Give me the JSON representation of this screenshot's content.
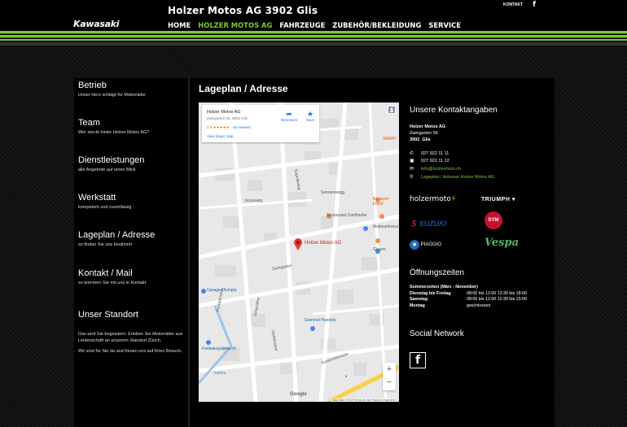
{
  "header": {
    "logo": "Kawasaki",
    "title": "Holzer Motos AG 3902 Glis",
    "top_link": "KONTAKT",
    "top_fb": "f",
    "nav": [
      "HOME",
      "HOLZER MOTOS AG",
      "FAHRZEUGE",
      "ZUBEHÖR/BEKLEIDUNG",
      "SERVICE"
    ],
    "active_nav": "HOLZER MOTOS AG",
    "accent": "#7cc832"
  },
  "sidebar": {
    "items": [
      {
        "title": "Betrieb",
        "sub": "Unser Herz schlägt für Motorräder"
      },
      {
        "title": "Team",
        "sub": "Wer steckt hinter Holzer Motos AG?"
      },
      {
        "title": "Dienstleistungen",
        "sub": "alle Angebote auf einen Blick"
      },
      {
        "title": "Werkstatt",
        "sub": "kompetent und zuverlässig"
      },
      {
        "title": "Lageplan / Adresse",
        "sub": "so finden Sie uns bestimmt"
      },
      {
        "title": "Kontakt / Mail",
        "sub": "so kommen Sie mit uns in Kontakt"
      }
    ],
    "standort_title": "Unser Standort",
    "standort_p1": "Das wird Sie begeistern: Erleben Sie Motorräder aus Leidenschaft an unserem Standort Zürich.",
    "standort_p2": "Wir sind für Sie da und freuen uns auf Ihren Besuch."
  },
  "main": {
    "title": "Lageplan / Adresse",
    "map": {
      "place_name": "Holzer Motos AG",
      "place_address": "Zwingarten 56, 3902 Glis",
      "rating": "4.6",
      "stars": "★★★★★",
      "reviews": "45 reviews",
      "larger_map": "View larger map",
      "directions": "Directions",
      "save": "Save",
      "pin_label": "Holzer Motos AG",
      "labels": {
        "restaurant": "Restaurant Zunftstube",
        "baeckerei": "Bäckerei Imhof",
        "gilsom": "Glisom",
        "malteserkreuz": "Malteserkreuz",
        "smart": "SMART",
        "garage": "Garage Olympia",
        "gemmel": "Gemmel Handels",
        "fantasie": "Fantasiegalasie.ch",
        "zwingarten": "Zwingarten",
        "jesusweg": "Jesusweg",
        "furkastrasse": "Furkastrasse",
        "gliserallee": "Gliserallee",
        "kapelleweg": "Kapelleweg",
        "sonnenwegg": "Sonnenwegg",
        "saltina": "Saltina",
        "dorfstrasse": "Dorfstrasse",
        "kantonsstrasse": "Kantonsstrasse",
        "route": "9"
      },
      "zoom_in": "+",
      "zoom_out": "−",
      "google": "Google",
      "footer": "Map data ©2019   Terms of Use   Report a map error"
    }
  },
  "contact": {
    "heading": "Unsere Kontaktangaben",
    "company": "Holzer Motos AG",
    "street": "Zwingarten 56",
    "city_zip": "3902",
    "city": "Glis",
    "phone": "027 922 11 11",
    "fax": "027 922 11 12",
    "email": "info@holzermoto.ch",
    "map_link": "Lageplan / Adresse Holzer Motos AG",
    "brands": {
      "holzer": "holzermoto",
      "triumph": "TRIUMPH",
      "suzuki": "SUZUKI",
      "sym": "SYM",
      "piaggio": "PIAGGIO",
      "vespa": "Vespa"
    },
    "hours_heading": "Öffnungszeiten",
    "hours_season": "Sommerzeiten  (März - November)",
    "hours": [
      {
        "day": "Dienstag bis Freitag",
        "time": "08:00 bis 12:00 13:30 bis 18:00"
      },
      {
        "day": "Samstag",
        "time": "08:00 bis 12:00 12:30 bis 15:00"
      },
      {
        "day": "Montag",
        "time": "geschlossen"
      }
    ],
    "social_heading": "Social Network",
    "social_fb": "f"
  }
}
